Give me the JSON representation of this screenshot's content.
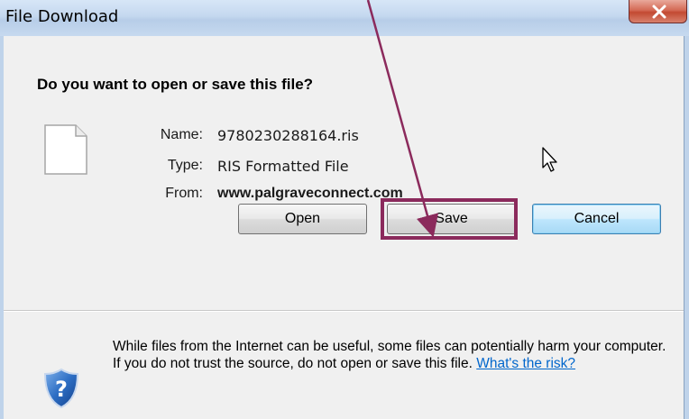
{
  "window": {
    "title": "File Download",
    "close_label": "X"
  },
  "dialog": {
    "question": "Do you want to open or save this file?",
    "file_info": {
      "name_label": "Name:",
      "name_value": "9780230288164.ris",
      "type_label": "Type:",
      "type_value": "RIS Formatted File",
      "from_label": "From:",
      "from_value": "www.palgraveconnect.com"
    },
    "buttons": {
      "open": "Open",
      "save": "Save",
      "cancel": "Cancel"
    },
    "warning": {
      "text": "While files from the Internet can be useful, some files can potentially harm your computer. If you do not trust the source, do not open or save this file.",
      "link": "What's the risk?"
    }
  },
  "icons": {
    "file": "file-icon",
    "shield": "shield-question-icon",
    "cursor": "mouse-pointer-icon",
    "annotation_arrow": "annotation-arrow"
  },
  "colors": {
    "annotation": "#8b2a5c",
    "link": "#0066cc",
    "dialog_bg": "#f0f0f0",
    "titlebar": "#c4d8ef",
    "close_button": "#c34a32"
  }
}
